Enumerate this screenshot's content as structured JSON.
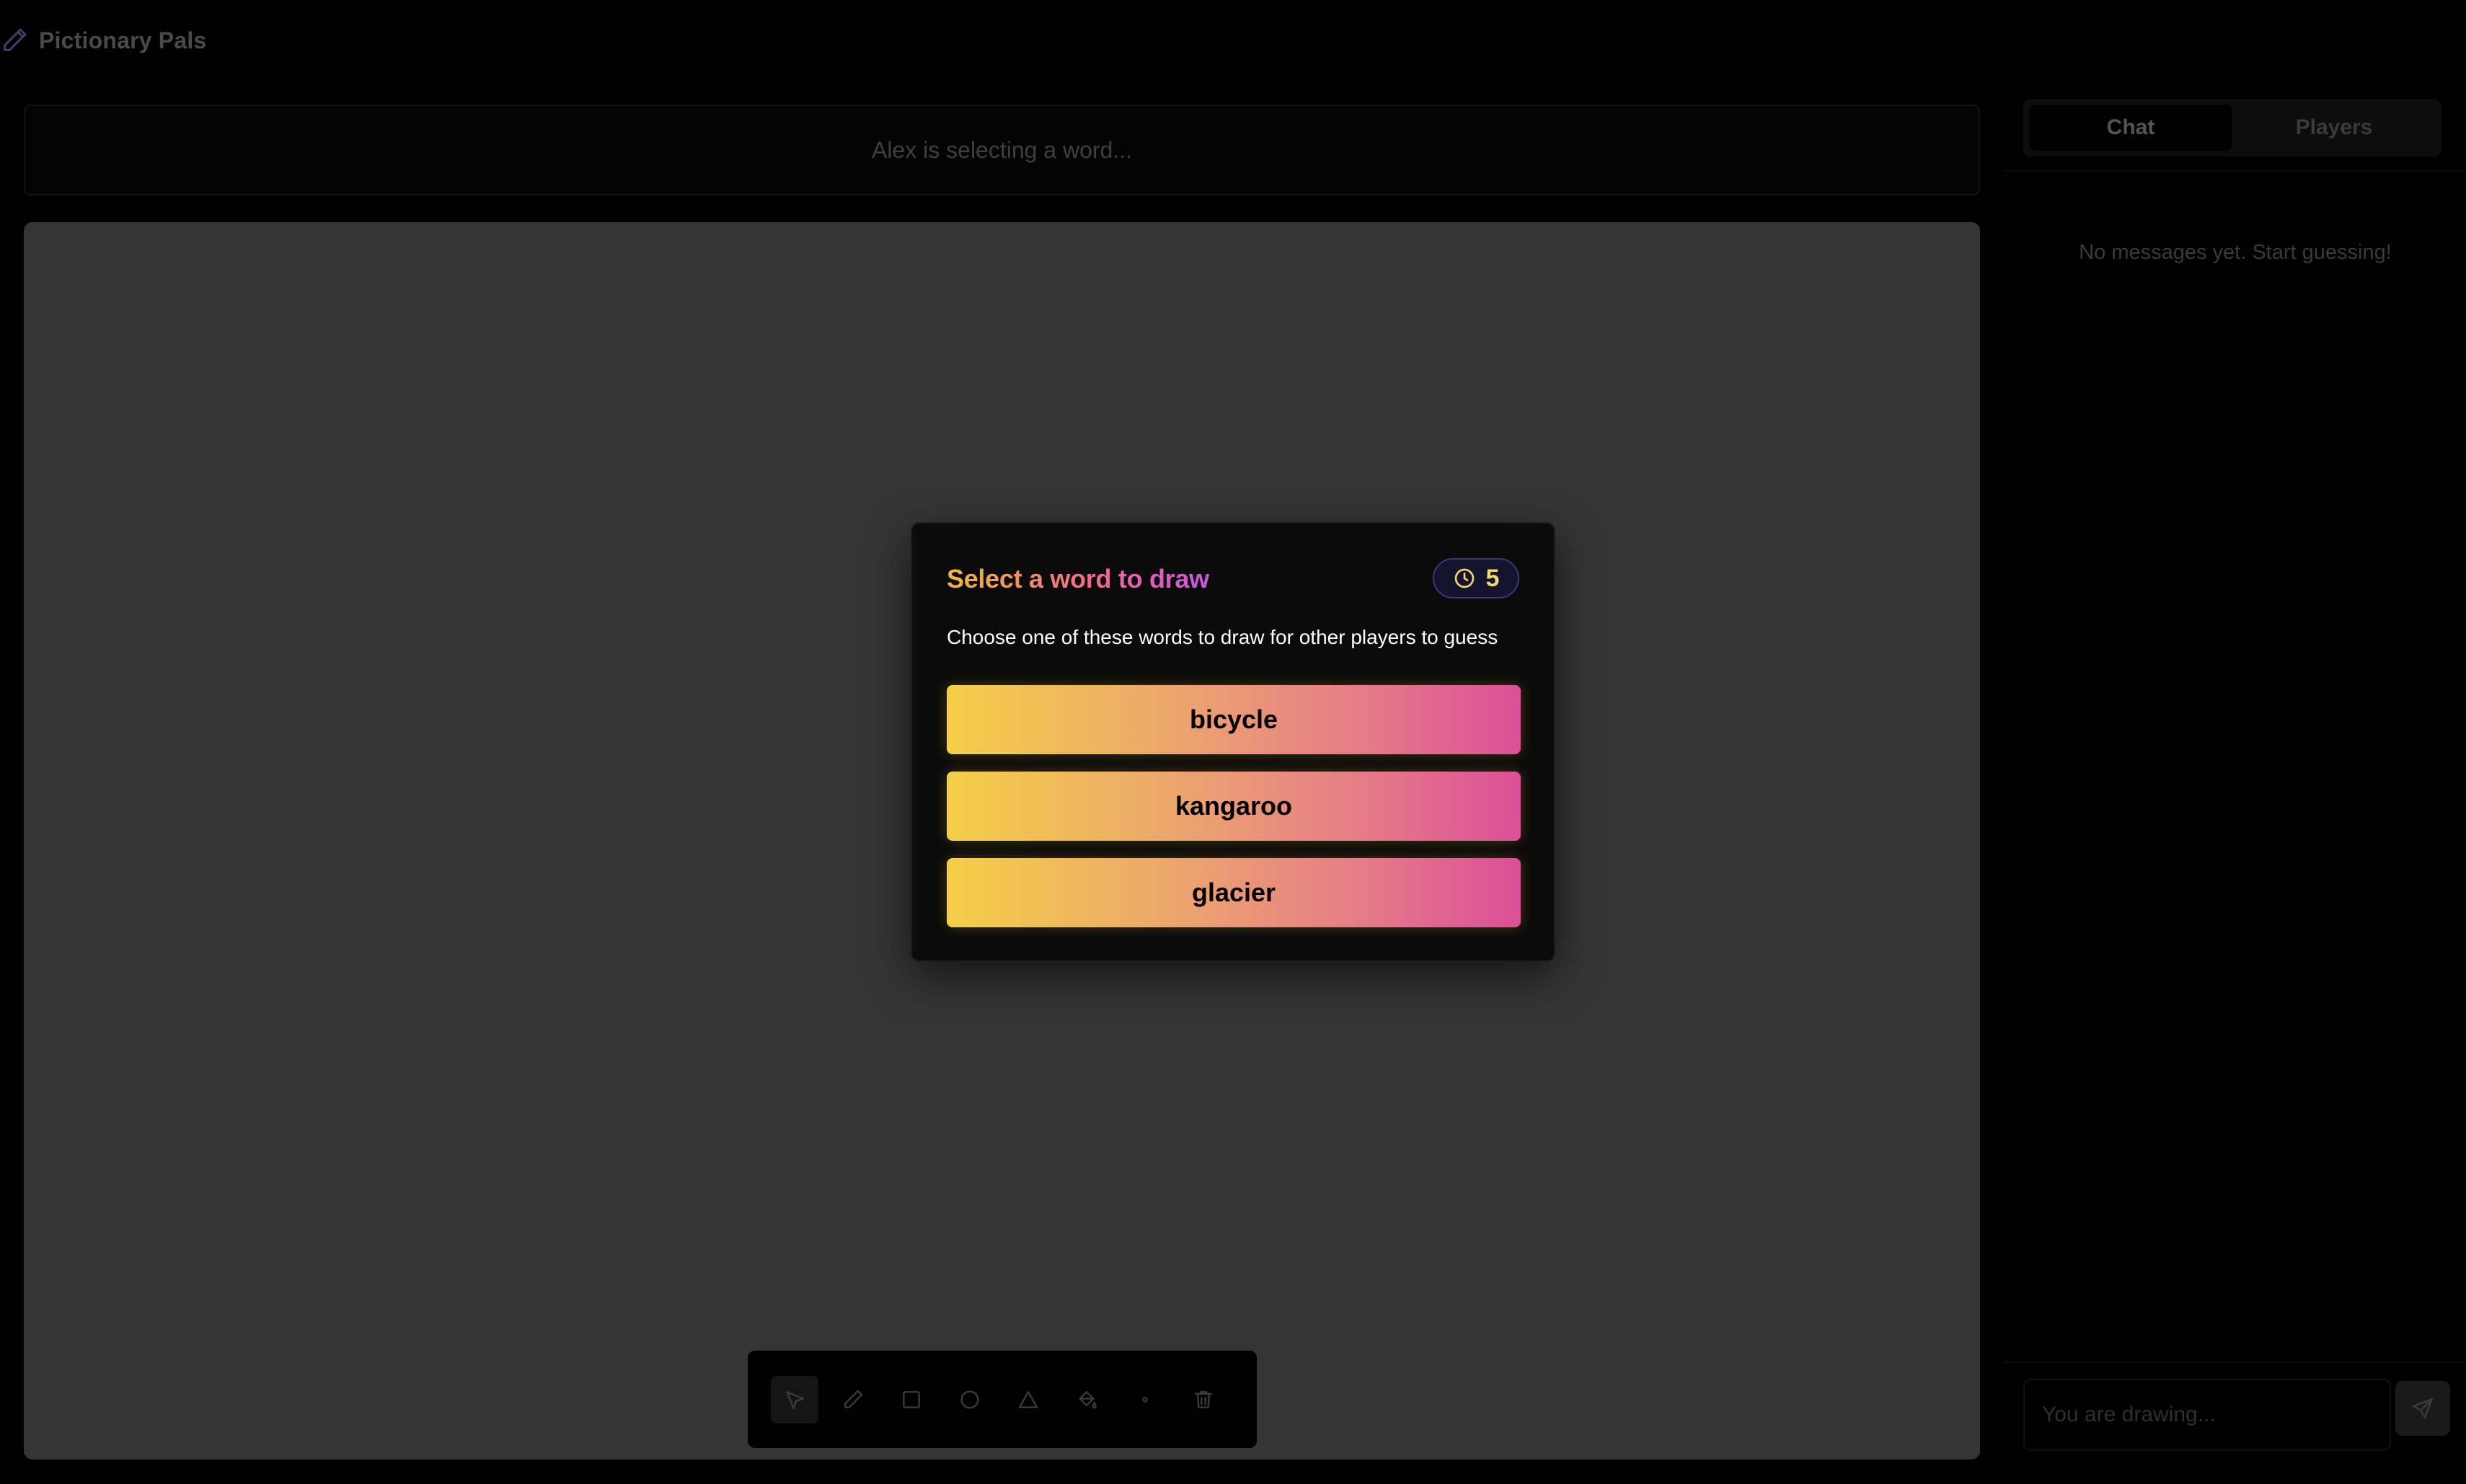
{
  "app": {
    "title": "Pictionary Pals",
    "logo_icon": "pencil-icon"
  },
  "status": {
    "text": "Alex is selecting a word..."
  },
  "modal": {
    "title": "Select a word to draw",
    "timer_icon": "clock-icon",
    "timer_value": "5",
    "description": "Choose one of these words to draw for other players to guess",
    "words": [
      "bicycle",
      "kangaroo",
      "glacier"
    ]
  },
  "toolbar": {
    "tools": [
      {
        "name": "select",
        "icon": "cursor-icon",
        "active": true
      },
      {
        "name": "pencil",
        "icon": "pencil-icon",
        "active": false
      },
      {
        "name": "rectangle",
        "icon": "square-icon",
        "active": false
      },
      {
        "name": "circle",
        "icon": "circle-icon",
        "active": false
      },
      {
        "name": "triangle",
        "icon": "triangle-icon",
        "active": false
      },
      {
        "name": "fill",
        "icon": "paint-bucket-icon",
        "active": false
      },
      {
        "name": "brush-size",
        "icon": "dot-icon",
        "active": false
      },
      {
        "name": "clear",
        "icon": "trash-icon",
        "active": false
      }
    ]
  },
  "sidebar": {
    "tabs": [
      {
        "label": "Chat",
        "active": true
      },
      {
        "label": "Players",
        "active": false
      }
    ],
    "empty_message": "No messages yet. Start guessing!",
    "input_placeholder": "You are drawing...",
    "send_icon": "send-icon"
  },
  "colors": {
    "background": "#000000",
    "canvas": "#353535",
    "modal_bg": "#0b0b0b",
    "gradient_start": "#f4cf47",
    "gradient_end": "#dc4f98",
    "timer_text": "#f5d76a",
    "timer_border": "#3a3a7a"
  }
}
